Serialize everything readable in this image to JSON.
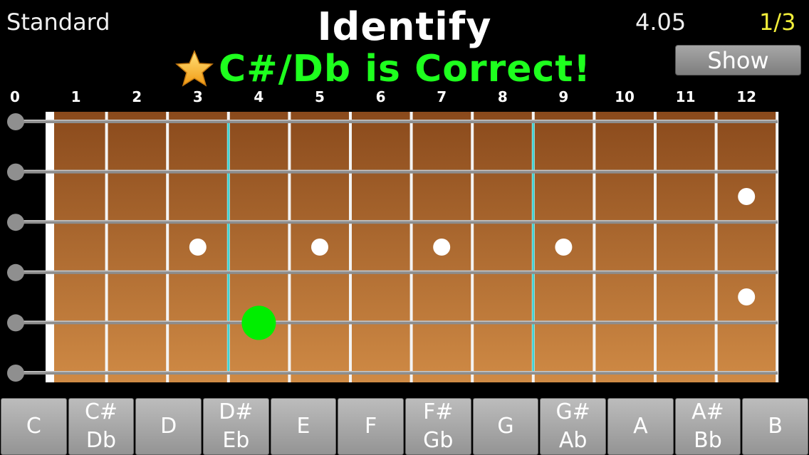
{
  "header": {
    "tuning_label": "Standard",
    "title": "Identify",
    "score": "4.05",
    "progress": "1/3",
    "feedback": "C#/Db is Correct!",
    "show_label": "Show"
  },
  "fret_numbers": [
    "0",
    "1",
    "2",
    "3",
    "4",
    "5",
    "6",
    "7",
    "8",
    "9",
    "10",
    "11",
    "12"
  ],
  "fretboard": {
    "string_count": 6,
    "fret_count": 12,
    "inlay_single_frets": [
      3,
      5,
      7,
      9
    ],
    "inlay_double_fret": 12,
    "highlight_box_frets": [
      4,
      8
    ],
    "marker": {
      "fret": 4,
      "string": 5,
      "color": "#00ee00"
    },
    "colors": {
      "wood_top": "#8a4a1c",
      "wood_bottom": "#cf8a45",
      "box": "#3fd3d3"
    }
  },
  "note_buttons": [
    {
      "line1": "C",
      "line2": ""
    },
    {
      "line1": "C#",
      "line2": "Db"
    },
    {
      "line1": "D",
      "line2": ""
    },
    {
      "line1": "D#",
      "line2": "Eb"
    },
    {
      "line1": "E",
      "line2": ""
    },
    {
      "line1": "F",
      "line2": ""
    },
    {
      "line1": "F#",
      "line2": "Gb"
    },
    {
      "line1": "G",
      "line2": ""
    },
    {
      "line1": "G#",
      "line2": "Ab"
    },
    {
      "line1": "A",
      "line2": ""
    },
    {
      "line1": "A#",
      "line2": "Bb"
    },
    {
      "line1": "B",
      "line2": ""
    }
  ]
}
